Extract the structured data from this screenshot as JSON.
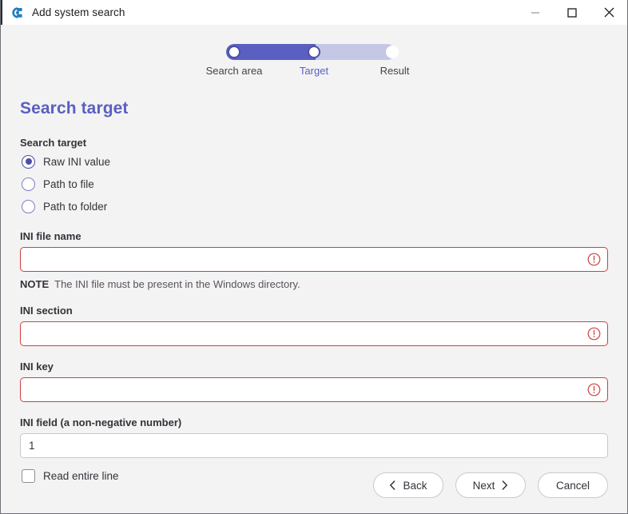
{
  "window": {
    "title": "Add system search",
    "app_icon": "app-logo-icon",
    "caption": {
      "minimize": "minimize-icon",
      "maximize": "maximize-icon",
      "close": "close-icon"
    }
  },
  "stepper": {
    "steps": [
      {
        "label": "Search area",
        "state": "complete"
      },
      {
        "label": "Target",
        "state": "current"
      },
      {
        "label": "Result",
        "state": "upcoming"
      }
    ],
    "active_index": 1,
    "fill_color": "#5b5fc1",
    "track_color": "#c5c8e4",
    "active_label_color": "#5b5fc1"
  },
  "page": {
    "title": "Search target",
    "title_color": "#5b5fc1"
  },
  "search_target": {
    "group_label": "Search target",
    "options": [
      {
        "label": "Raw INI value",
        "checked": true
      },
      {
        "label": "Path to file",
        "checked": false
      },
      {
        "label": "Path to folder",
        "checked": false
      }
    ]
  },
  "fields": {
    "ini_file_name": {
      "label": "INI file name",
      "value": "",
      "placeholder": "",
      "error": true,
      "error_icon": "error-circle-icon"
    },
    "note": {
      "bold": "NOTE",
      "text": "The INI file must be present in the Windows directory."
    },
    "ini_section": {
      "label": "INI section",
      "value": "",
      "placeholder": "",
      "error": true,
      "error_icon": "error-circle-icon"
    },
    "ini_key": {
      "label": "INI key",
      "value": "",
      "placeholder": "",
      "error": true,
      "error_icon": "error-circle-icon"
    },
    "ini_field": {
      "label": "INI field (a non-negative number)",
      "value": "1",
      "placeholder": "",
      "error": false
    },
    "read_entire_line": {
      "label": "Read entire line",
      "checked": false
    }
  },
  "footer": {
    "back": {
      "label": "Back",
      "icon": "chevron-left-icon"
    },
    "next": {
      "label": "Next",
      "icon": "chevron-right-icon"
    },
    "cancel": {
      "label": "Cancel"
    }
  },
  "colors": {
    "accent": "#5b5fc1",
    "error": "#cf4040",
    "window_background": "#f3f3f3",
    "titlebar_background": "#ffffff"
  }
}
